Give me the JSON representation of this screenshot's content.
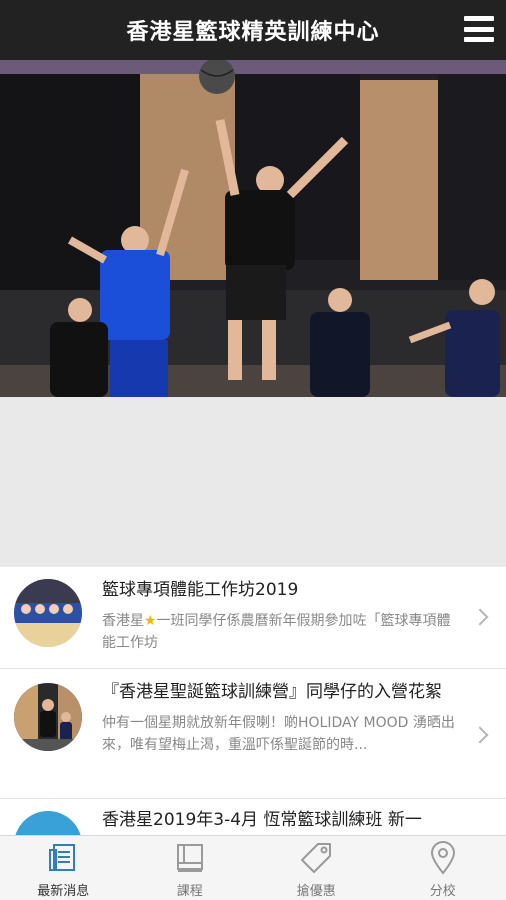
{
  "header": {
    "title": "香港星籃球精英訓練中心"
  },
  "news": [
    {
      "title": "籃球專項體能工作坊2019",
      "desc_before": "香港星",
      "desc_after": "一班同學仔係農曆新年假期參加咗「籃球專項體能工作坊"
    },
    {
      "title": "『香港星聖誕籃球訓練營』同學仔的入營花絮",
      "desc": "仲有一個星期就放新年假喇！啲HOLIDAY MOOD 湧晒出來，唯有望梅止渴，重溫吓係聖誕節的時..."
    },
    {
      "title": "香港星2019年3-4月 恆常籃球訓練班 新一"
    }
  ],
  "tabs": [
    {
      "label": "最新消息",
      "icon": "news-icon"
    },
    {
      "label": "課程",
      "icon": "book-icon"
    },
    {
      "label": "搶優惠",
      "icon": "tag-icon"
    },
    {
      "label": "分校",
      "icon": "location-pin-icon"
    }
  ],
  "colors": {
    "header_bg": "#222222",
    "active_tab": "#2d7fc1",
    "inactive_tab": "#9a9a9a"
  }
}
